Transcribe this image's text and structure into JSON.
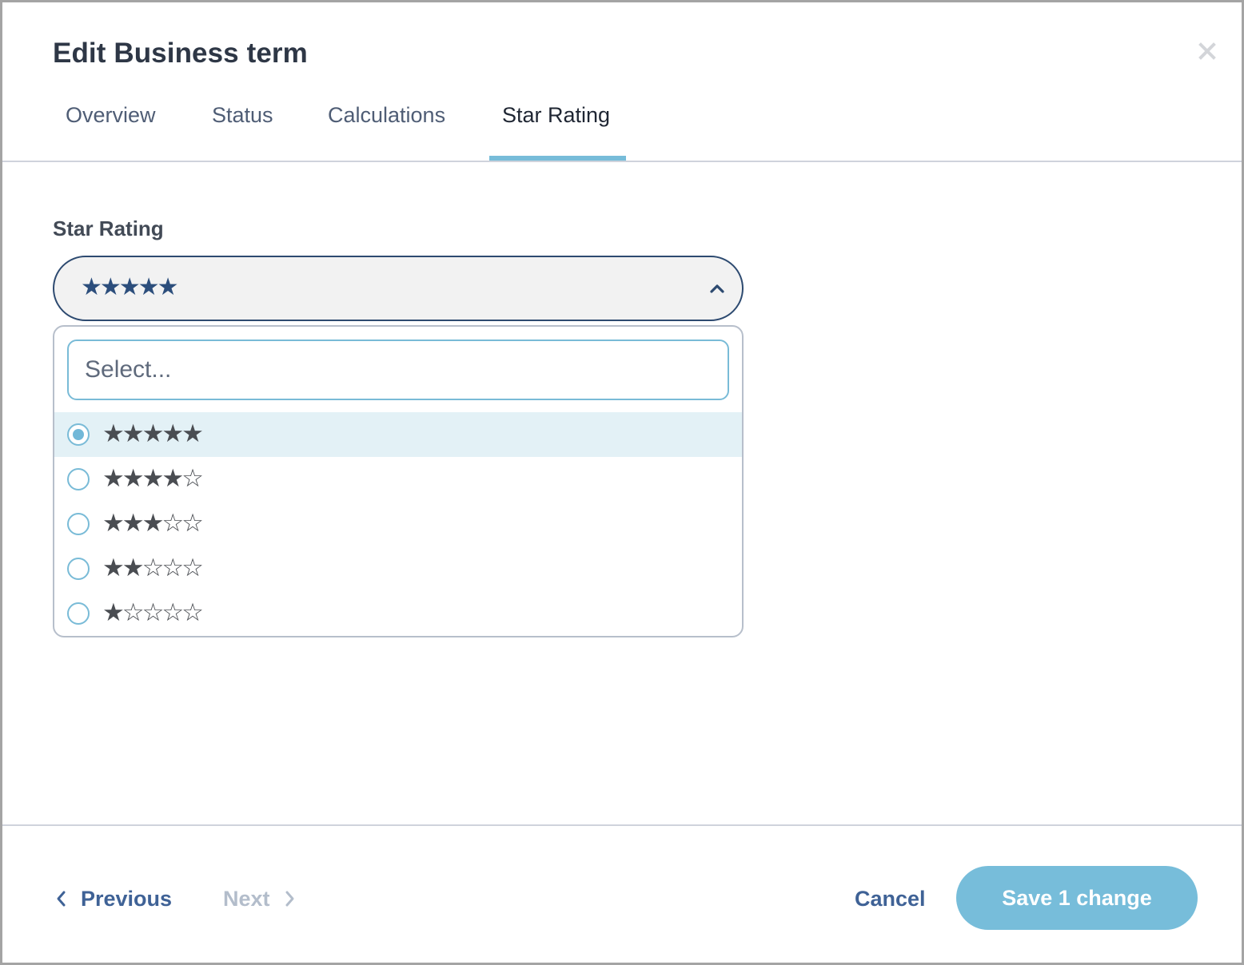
{
  "dialog": {
    "title": "Edit Business term",
    "close_icon": "close-icon"
  },
  "tabs": [
    {
      "label": "Overview",
      "active": false
    },
    {
      "label": "Status",
      "active": false
    },
    {
      "label": "Calculations",
      "active": false
    },
    {
      "label": "Star Rating",
      "active": true
    }
  ],
  "field": {
    "label": "Star Rating",
    "selected_value": "★★★★★",
    "selected_rating": 5,
    "expanded": true,
    "chevron_icon": "chevron-up-icon"
  },
  "dropdown": {
    "search_placeholder": "Select...",
    "search_value": "",
    "options": [
      {
        "stars": "★★★★★",
        "rating": 5,
        "selected": true
      },
      {
        "stars": "★★★★☆",
        "rating": 4,
        "selected": false
      },
      {
        "stars": "★★★☆☆",
        "rating": 3,
        "selected": false
      },
      {
        "stars": "★★☆☆☆",
        "rating": 2,
        "selected": false
      },
      {
        "stars": "★☆☆☆☆",
        "rating": 1,
        "selected": false
      }
    ]
  },
  "footer": {
    "previous_label": "Previous",
    "next_label": "Next",
    "next_disabled": true,
    "cancel_label": "Cancel",
    "save_label": "Save 1 change"
  },
  "colors": {
    "accent": "#77bdda",
    "link": "#3f6296",
    "disabled": "#b3bdcb",
    "selected_row": "#e3f1f6",
    "select_border": "#2d4a70"
  }
}
